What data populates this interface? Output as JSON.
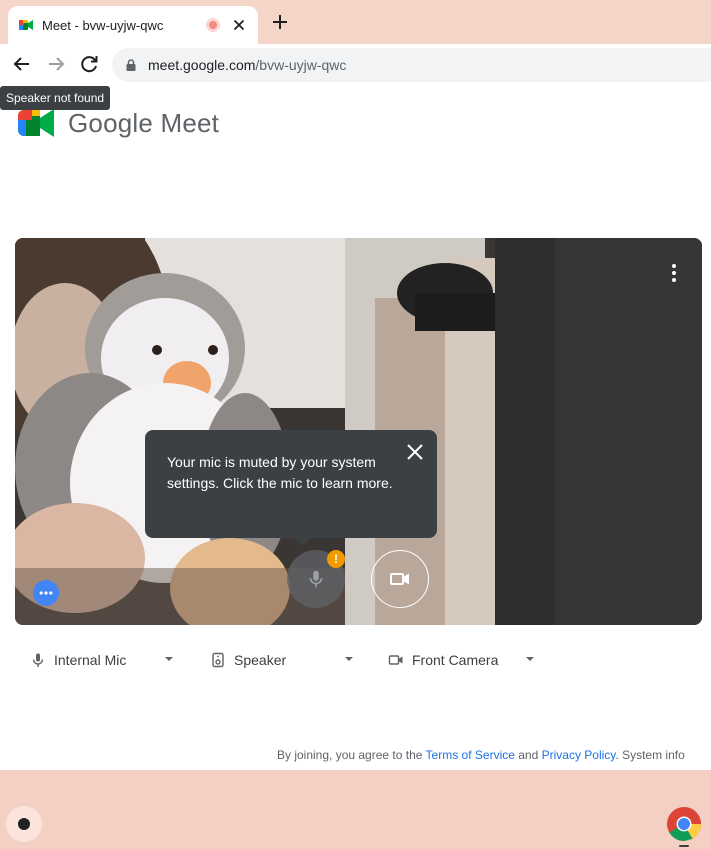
{
  "browser": {
    "tab": {
      "title": "Meet - bvw-uyjw-qwc"
    },
    "address_bar": {
      "host": "meet.google.com",
      "path": "/bvw-uyjw-qwc"
    },
    "tooltip": "Speaker not found"
  },
  "page": {
    "brand": "Google Meet",
    "preview": {
      "callout_text": "Your mic is muted by your system settings. Click the mic to learn more.",
      "mic_warning": "!"
    },
    "devices": [
      {
        "label": "Internal Mic"
      },
      {
        "label": "Speaker"
      },
      {
        "label": "Front Camera"
      }
    ],
    "legal": {
      "prefix": "By joining, you agree to the ",
      "terms": "Terms of Service",
      "and": " and ",
      "privacy": "Privacy Policy",
      "suffix": ". System info"
    }
  },
  "colors": {
    "accent": "#1a73e8",
    "shelf": "#f4cfc3",
    "warning": "#f29900"
  }
}
